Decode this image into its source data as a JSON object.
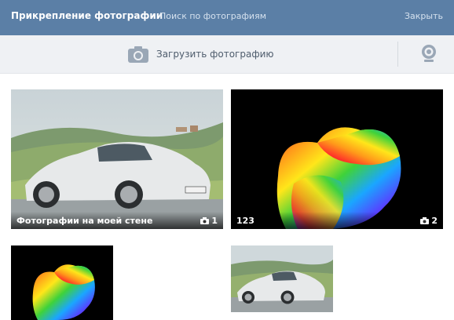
{
  "header": {
    "title": "Прикрепление фотографии",
    "search_link": "Поиск по фотографиям",
    "close_link": "Закрыть"
  },
  "toolbar": {
    "upload_label": "Загрузить фотографию",
    "upload_icon": "camera-icon",
    "webcam_icon": "webcam-icon"
  },
  "albums": [
    {
      "name": "Фотографии на моей стене",
      "count": "1"
    },
    {
      "name": "123",
      "count": "2"
    }
  ],
  "colors": {
    "header_bg": "#5b7fa6",
    "toolbar_bg": "#eff1f4",
    "icon": "#9aa7b6"
  }
}
